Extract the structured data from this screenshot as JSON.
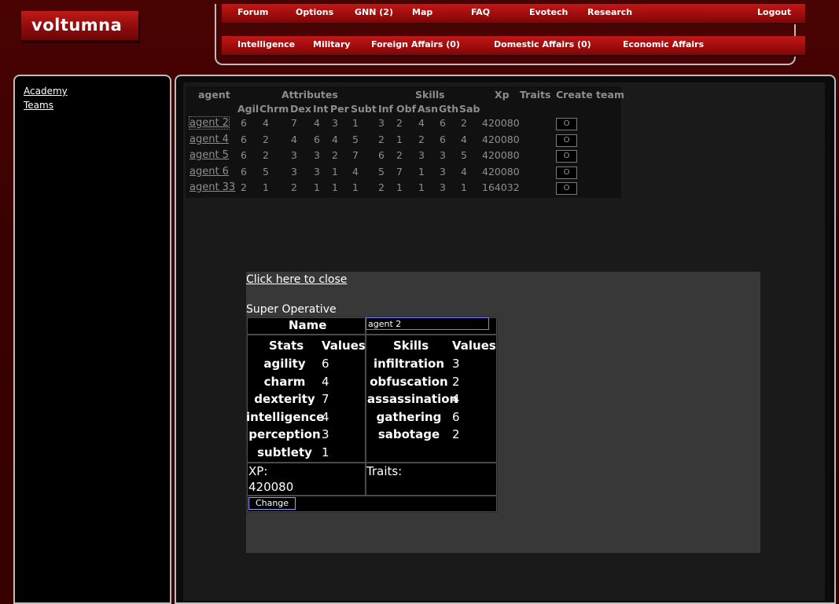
{
  "brand": {
    "logo_text": "voltumna"
  },
  "nav": {
    "row1": [
      "Forum",
      "Options",
      "GNN (2)",
      "Map",
      "FAQ",
      "Evotech",
      "Research",
      "Logout"
    ],
    "row2": [
      "Intelligence",
      "Military",
      "Foreign Affairs (0)",
      "Domestic Affairs (0)",
      "Economic Affairs"
    ]
  },
  "sidebar": {
    "items": [
      "Academy",
      "Teams"
    ]
  },
  "agents_table": {
    "headers": {
      "agent": "agent",
      "attributes": "Attributes",
      "skills": "Skills",
      "xp": "Xp",
      "traits": "Traits",
      "create_team": "Create team"
    },
    "sub_headers": [
      "Agil",
      "Chrm",
      "Dex",
      "Int",
      "Per",
      "Subt",
      "Inf",
      "Obf",
      "Asn",
      "Gth",
      "Sab"
    ],
    "rows": [
      {
        "name": "agent 2",
        "values": [
          "6",
          "4",
          "7",
          "4",
          "3",
          "1",
          "3",
          "2",
          "4",
          "6",
          "2"
        ],
        "xp": "420080",
        "button": "O"
      },
      {
        "name": "agent 4",
        "values": [
          "6",
          "2",
          "4",
          "6",
          "4",
          "5",
          "2",
          "1",
          "2",
          "6",
          "4"
        ],
        "xp": "420080",
        "button": "O"
      },
      {
        "name": "agent 5",
        "values": [
          "6",
          "2",
          "3",
          "3",
          "2",
          "7",
          "6",
          "2",
          "3",
          "3",
          "5"
        ],
        "xp": "420080",
        "button": "O"
      },
      {
        "name": "agent 6",
        "values": [
          "6",
          "5",
          "3",
          "3",
          "1",
          "4",
          "5",
          "7",
          "1",
          "3",
          "4"
        ],
        "xp": "420080",
        "button": "O"
      },
      {
        "name": "agent 33",
        "values": [
          "2",
          "1",
          "2",
          "1",
          "1",
          "1",
          "2",
          "1",
          "1",
          "3",
          "1"
        ],
        "xp": "164032",
        "button": "O"
      }
    ]
  },
  "popup": {
    "close_label": "Click here to close",
    "title": "Super Operative",
    "name_label": "Name",
    "name_value": "agent 2",
    "stats_header": "Stats",
    "values_header": "Values",
    "skills_header": "Skills",
    "stats": [
      {
        "label": "agility",
        "value": "6"
      },
      {
        "label": "charm",
        "value": "4"
      },
      {
        "label": "dexterity",
        "value": "7"
      },
      {
        "label": "intelligence",
        "value": "4"
      },
      {
        "label": "perception",
        "value": "3"
      },
      {
        "label": "subtlety",
        "value": "1"
      }
    ],
    "skills": [
      {
        "label": "infiltration",
        "value": "3"
      },
      {
        "label": "obfuscation",
        "value": "2"
      },
      {
        "label": "assassination",
        "value": "4"
      },
      {
        "label": "gathering",
        "value": "6"
      },
      {
        "label": "sabotage",
        "value": "2"
      }
    ],
    "xp_label": "XP:",
    "xp_value": "420080",
    "traits_label": "Traits:",
    "change_label": "Change"
  }
}
